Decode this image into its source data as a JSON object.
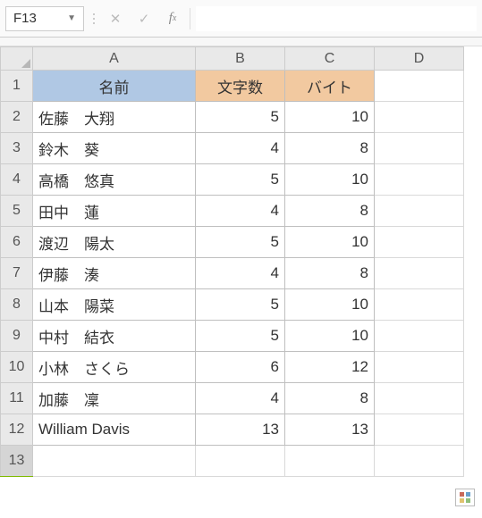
{
  "nameBox": "F13",
  "formula": "",
  "columns": [
    "A",
    "B",
    "C",
    "D"
  ],
  "colWidths": {
    "A": 182,
    "B": 100,
    "C": 100,
    "D": 100
  },
  "headers": {
    "A": "名前",
    "B": "文字数",
    "C": "バイト"
  },
  "rows": [
    {
      "n": 1,
      "A": "名前",
      "B": "文字数",
      "C": "バイト",
      "isHeader": true
    },
    {
      "n": 2,
      "A": "佐藤　大翔",
      "B": 5,
      "C": 10
    },
    {
      "n": 3,
      "A": "鈴木　葵",
      "B": 4,
      "C": 8
    },
    {
      "n": 4,
      "A": "高橋　悠真",
      "B": 5,
      "C": 10
    },
    {
      "n": 5,
      "A": "田中　蓮",
      "B": 4,
      "C": 8
    },
    {
      "n": 6,
      "A": "渡辺　陽太",
      "B": 5,
      "C": 10
    },
    {
      "n": 7,
      "A": "伊藤　湊",
      "B": 4,
      "C": 8
    },
    {
      "n": 8,
      "A": "山本　陽菜",
      "B": 5,
      "C": 10
    },
    {
      "n": 9,
      "A": "中村　結衣",
      "B": 5,
      "C": 10
    },
    {
      "n": 10,
      "A": "小林　さくら",
      "B": 6,
      "C": 12
    },
    {
      "n": 11,
      "A": "加藤　凜",
      "B": 4,
      "C": 8
    },
    {
      "n": 12,
      "A": "William Davis",
      "B": 13,
      "C": 13
    },
    {
      "n": 13,
      "A": "",
      "B": "",
      "C": "",
      "isEmpty": true
    }
  ],
  "activeCell": "F13",
  "chart_data": {
    "type": "table",
    "columns": [
      "名前",
      "文字数",
      "バイト"
    ],
    "rows": [
      [
        "佐藤　大翔",
        5,
        10
      ],
      [
        "鈴木　葵",
        4,
        8
      ],
      [
        "高橋　悠真",
        5,
        10
      ],
      [
        "田中　蓮",
        4,
        8
      ],
      [
        "渡辺　陽太",
        5,
        10
      ],
      [
        "伊藤　湊",
        4,
        8
      ],
      [
        "山本　陽菜",
        5,
        10
      ],
      [
        "中村　結衣",
        5,
        10
      ],
      [
        "小林　さくら",
        6,
        12
      ],
      [
        "加藤　凜",
        4,
        8
      ],
      [
        "William Davis",
        13,
        13
      ]
    ]
  }
}
